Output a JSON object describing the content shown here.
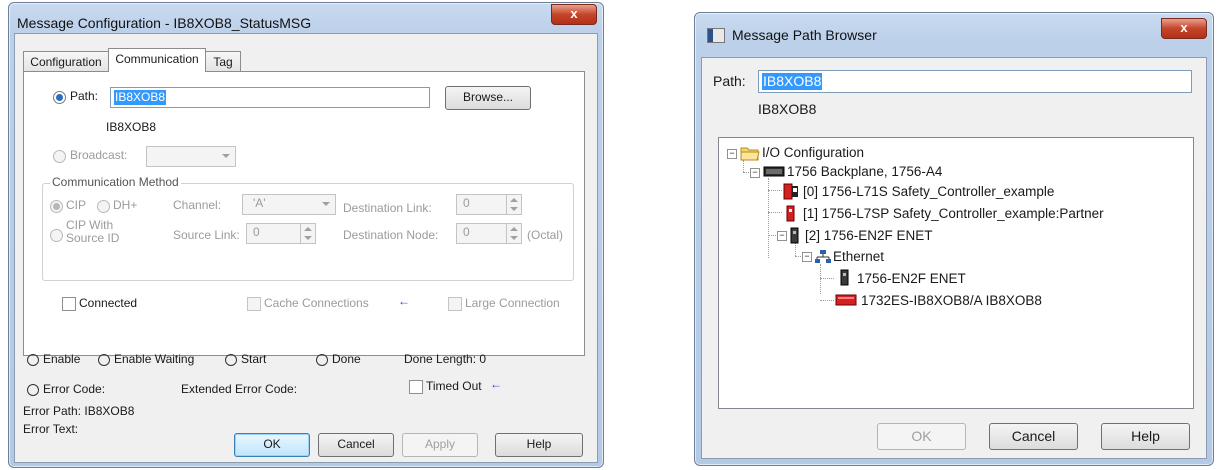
{
  "left_dialog": {
    "title": "Message Configuration - IB8XOB8_StatusMSG",
    "close_glyph": "x",
    "tabs": [
      "Configuration",
      "Communication",
      "Tag"
    ],
    "path_label": "Path:",
    "path_value": "IB8XOB8",
    "path_resolved": "IB8XOB8",
    "browse_label": "Browse...",
    "broadcast_label": "Broadcast:",
    "comm_method": {
      "group_label": "Communication Method",
      "cip": "CIP",
      "dh_plus": "DH+",
      "channel_label": "Channel:",
      "channel_value": "'A'",
      "dest_link_label": "Destination Link:",
      "dest_link_value": "0",
      "cip_with_source_id": "CIP With Source ID",
      "source_link_label": "Source Link:",
      "source_link_value": "0",
      "dest_node_label": "Destination Node:",
      "dest_node_value": "0",
      "octal_label": "(Octal)"
    },
    "connected_label": "Connected",
    "cache_connections_label": "Cache Connections",
    "large_connection_label": "Large Connection",
    "status": {
      "enable": "Enable",
      "enable_waiting": "Enable Waiting",
      "start": "Start",
      "done": "Done",
      "done_length": "Done Length: 0",
      "error_code": "Error Code:",
      "extended_error_code": "Extended Error Code:",
      "timed_out": "Timed Out",
      "error_path": "Error Path: IB8XOB8",
      "error_text": "Error Text:"
    },
    "buttons": {
      "ok": "OK",
      "cancel": "Cancel",
      "apply": "Apply",
      "help": "Help"
    },
    "arrow_glyph": "←"
  },
  "right_dialog": {
    "title": "Message Path Browser",
    "close_glyph": "x",
    "path_label": "Path:",
    "path_value": "IB8XOB8",
    "path_resolved": "IB8XOB8",
    "tree": [
      {
        "label": "I/O Configuration",
        "icon": "folder-icon"
      },
      {
        "label": "1756 Backplane, 1756-A4",
        "icon": "backplane-icon"
      },
      {
        "label": "[0] 1756-L71S Safety_Controller_example",
        "icon": "safety-controller-icon"
      },
      {
        "label": "[1] 1756-L7SP Safety_Controller_example:Partner",
        "icon": "safety-partner-icon"
      },
      {
        "label": "[2] 1756-EN2F ENET",
        "icon": "module-icon"
      },
      {
        "label": "Ethernet",
        "icon": "network-icon"
      },
      {
        "label": "1756-EN2F ENET",
        "icon": "module-icon"
      },
      {
        "label": "1732ES-IB8XOB8/A IB8XOB8",
        "icon": "io-block-icon"
      }
    ],
    "buttons": {
      "ok": "OK",
      "cancel": "Cancel",
      "help": "Help"
    }
  },
  "colors": {
    "selection": "#3399ff",
    "safety_red": "#d42020",
    "arrow_blue": "#1f4fc2"
  }
}
